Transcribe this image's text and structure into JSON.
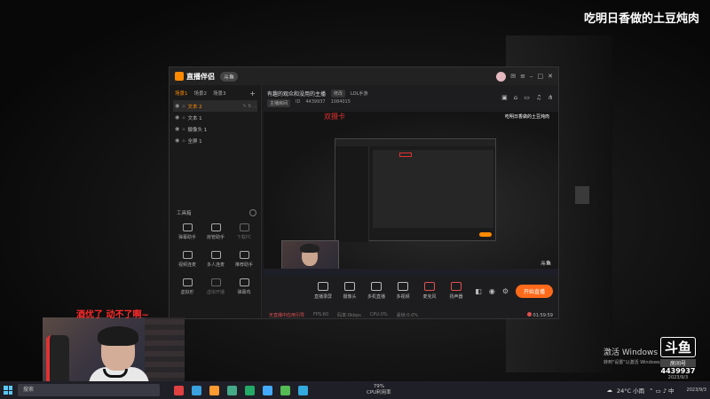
{
  "overlay": {
    "streamer_title": "吃明日香做的土豆炖肉",
    "danmaku": "酒优了 动不了啊~"
  },
  "app": {
    "logo_text": "直播伴侣",
    "badge": "斗鱼",
    "sidebar": {
      "tabs": [
        "场景1",
        "场景2",
        "场景3"
      ],
      "layers": [
        {
          "name": "文本 2",
          "active": true
        },
        {
          "name": "文本 1",
          "active": false
        },
        {
          "name": "摄像头 1",
          "active": false
        },
        {
          "name": "全屏 1",
          "active": false
        }
      ],
      "tools_title": "工具箱",
      "tools": [
        {
          "label": "弹幕助手",
          "dim": false
        },
        {
          "label": "房管助手",
          "dim": false
        },
        {
          "label": "下载PC",
          "dim": true
        },
        {
          "label": "视频连麦",
          "dim": false
        },
        {
          "label": "多人连麦",
          "dim": false
        },
        {
          "label": "推荐助手",
          "dim": false
        },
        {
          "label": "虚拟形",
          "dim": false
        },
        {
          "label": "虚拟开播",
          "dim": true
        },
        {
          "label": "弹幕鸡",
          "dim": false
        }
      ],
      "footer_warning": "无直播中应用引导"
    },
    "stream": {
      "title": "有趣的观众和没用的主播",
      "title_edit": "修改",
      "category": "LOL手游",
      "room_label": "主播房间",
      "room_owner": "ID",
      "viewers": "4439937",
      "fans": "1084015"
    },
    "preview": {
      "label": "双摄卡",
      "watermark": "吃明日香做的土豆炖肉",
      "mark": "斗鱼"
    },
    "bottom_tools": [
      "直播录屏",
      "摄像头",
      "多机直播",
      "多视频",
      "麦克风",
      "扬声器"
    ],
    "start_live": "开始直播",
    "status": {
      "warning": "无直播中应用引导",
      "fps": "FPS:60",
      "bitrate": "码率:0kbps",
      "cpu": "CPU:0%",
      "drop": "丢帧:0.0%",
      "time": "01:59:59"
    }
  },
  "windows_activation": {
    "title": "激活 Windows",
    "subtitle": "转到\"设置\"以激活 Windows。"
  },
  "douyu": {
    "mark": "斗鱼",
    "room_label": "房间号",
    "room_number": "4439937",
    "date": "2023/9/3"
  },
  "taskbar": {
    "search_placeholder": "搜索",
    "cpu_label": "79%",
    "cpu_text": "CPU利用率",
    "weather": "24°C 小雨",
    "time": "",
    "date": "2023/9/3",
    "app_colors": [
      "#e04040",
      "#3aa0e0",
      "#ff9a30",
      "#4a8",
      "#2a6",
      "#4af",
      "#5b5",
      "#3ad"
    ]
  }
}
